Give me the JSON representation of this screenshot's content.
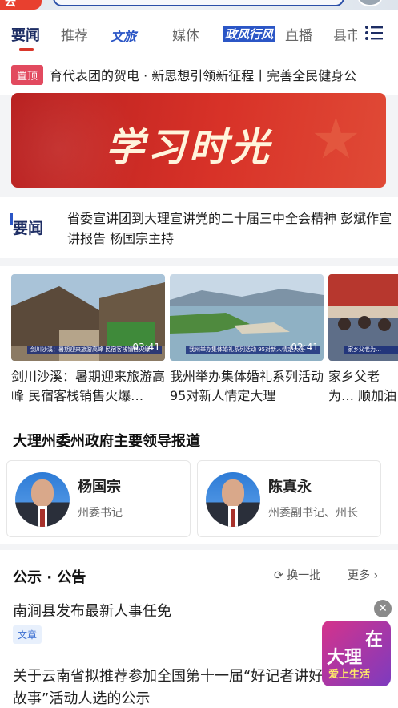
{
  "app": {
    "logo_text": "云"
  },
  "tabs": [
    {
      "label": "要闻",
      "active": true
    },
    {
      "label": "推荐"
    },
    {
      "label": "文旅",
      "logo": true
    },
    {
      "label": "媒体"
    },
    {
      "label": "政风行风",
      "logo_box": true
    },
    {
      "label": "直播"
    },
    {
      "label": "县市"
    }
  ],
  "ticker": {
    "badge": "置顶",
    "text": "育代表团的贺电   ·  新思想引领新征程丨完善全民健身公"
  },
  "banner": {
    "title": "学习时光"
  },
  "yaowen": {
    "logo": "要闻",
    "headline": "省委宣讲团到大理宣讲党的二十届三中全会精神 彭斌作宣讲报告 杨国宗主持"
  },
  "videos": [
    {
      "title": "剑川沙溪：暑期迎来旅游高峰 民宿客栈销售火爆…",
      "duration": "03:41",
      "caption": "剑川沙溪：暑期迎来旅游高峰 民宿客栈销售火爆"
    },
    {
      "title": "我州举办集体婚礼系列活动 95对新人情定大理",
      "duration": "02:41",
      "caption": "我州举办集体婚礼系列活动 95对新人情定大理"
    },
    {
      "title": "家乡父老为… 顺加油",
      "duration": "",
      "caption": "家乡父老为…"
    }
  ],
  "leaders": {
    "title": "大理州委州政府主要领导报道",
    "items": [
      {
        "name": "杨国宗",
        "role": "州委书记"
      },
      {
        "name": "陈真永",
        "role": "州委副书记、州长"
      }
    ]
  },
  "notices": {
    "title": "公示 · 公告",
    "refresh": "换一批",
    "more": "更多",
    "items": [
      {
        "title": "南涧县发布最新人事任免",
        "tag": "文章"
      },
      {
        "title": "关于云南省拟推荐参加全国第十一届“好记者讲好故事”活动人选的公示"
      }
    ]
  },
  "float_badge": {
    "line1": "在",
    "line2": "大理",
    "line3": "爱上生活"
  },
  "colors": {
    "accent": "#d9372b",
    "brand_blue": "#1d2d64",
    "link_blue": "#2b56c6"
  }
}
